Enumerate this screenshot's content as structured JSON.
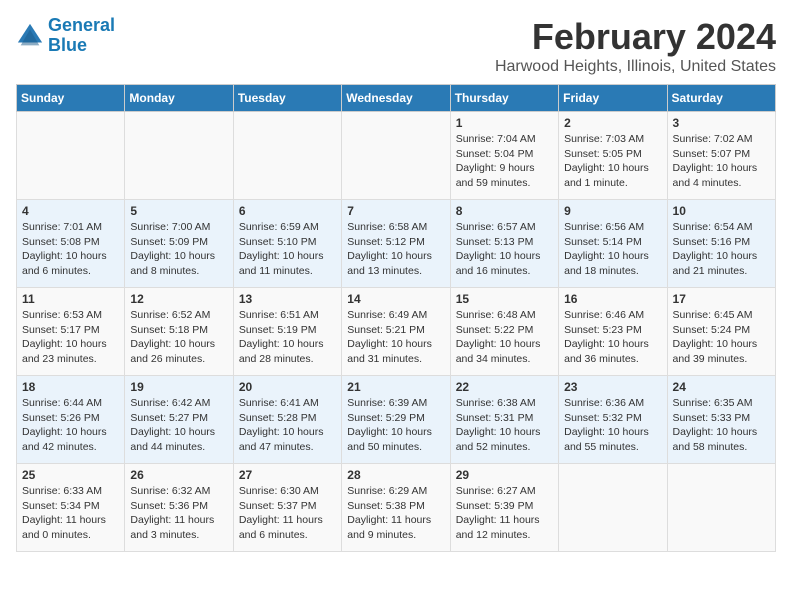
{
  "logo": {
    "line1": "General",
    "line2": "Blue"
  },
  "title": "February 2024",
  "subtitle": "Harwood Heights, Illinois, United States",
  "headers": [
    "Sunday",
    "Monday",
    "Tuesday",
    "Wednesday",
    "Thursday",
    "Friday",
    "Saturday"
  ],
  "weeks": [
    [
      {
        "day": "",
        "info": ""
      },
      {
        "day": "",
        "info": ""
      },
      {
        "day": "",
        "info": ""
      },
      {
        "day": "",
        "info": ""
      },
      {
        "day": "1",
        "info": "Sunrise: 7:04 AM\nSunset: 5:04 PM\nDaylight: 9 hours\nand 59 minutes."
      },
      {
        "day": "2",
        "info": "Sunrise: 7:03 AM\nSunset: 5:05 PM\nDaylight: 10 hours\nand 1 minute."
      },
      {
        "day": "3",
        "info": "Sunrise: 7:02 AM\nSunset: 5:07 PM\nDaylight: 10 hours\nand 4 minutes."
      }
    ],
    [
      {
        "day": "4",
        "info": "Sunrise: 7:01 AM\nSunset: 5:08 PM\nDaylight: 10 hours\nand 6 minutes."
      },
      {
        "day": "5",
        "info": "Sunrise: 7:00 AM\nSunset: 5:09 PM\nDaylight: 10 hours\nand 8 minutes."
      },
      {
        "day": "6",
        "info": "Sunrise: 6:59 AM\nSunset: 5:10 PM\nDaylight: 10 hours\nand 11 minutes."
      },
      {
        "day": "7",
        "info": "Sunrise: 6:58 AM\nSunset: 5:12 PM\nDaylight: 10 hours\nand 13 minutes."
      },
      {
        "day": "8",
        "info": "Sunrise: 6:57 AM\nSunset: 5:13 PM\nDaylight: 10 hours\nand 16 minutes."
      },
      {
        "day": "9",
        "info": "Sunrise: 6:56 AM\nSunset: 5:14 PM\nDaylight: 10 hours\nand 18 minutes."
      },
      {
        "day": "10",
        "info": "Sunrise: 6:54 AM\nSunset: 5:16 PM\nDaylight: 10 hours\nand 21 minutes."
      }
    ],
    [
      {
        "day": "11",
        "info": "Sunrise: 6:53 AM\nSunset: 5:17 PM\nDaylight: 10 hours\nand 23 minutes."
      },
      {
        "day": "12",
        "info": "Sunrise: 6:52 AM\nSunset: 5:18 PM\nDaylight: 10 hours\nand 26 minutes."
      },
      {
        "day": "13",
        "info": "Sunrise: 6:51 AM\nSunset: 5:19 PM\nDaylight: 10 hours\nand 28 minutes."
      },
      {
        "day": "14",
        "info": "Sunrise: 6:49 AM\nSunset: 5:21 PM\nDaylight: 10 hours\nand 31 minutes."
      },
      {
        "day": "15",
        "info": "Sunrise: 6:48 AM\nSunset: 5:22 PM\nDaylight: 10 hours\nand 34 minutes."
      },
      {
        "day": "16",
        "info": "Sunrise: 6:46 AM\nSunset: 5:23 PM\nDaylight: 10 hours\nand 36 minutes."
      },
      {
        "day": "17",
        "info": "Sunrise: 6:45 AM\nSunset: 5:24 PM\nDaylight: 10 hours\nand 39 minutes."
      }
    ],
    [
      {
        "day": "18",
        "info": "Sunrise: 6:44 AM\nSunset: 5:26 PM\nDaylight: 10 hours\nand 42 minutes."
      },
      {
        "day": "19",
        "info": "Sunrise: 6:42 AM\nSunset: 5:27 PM\nDaylight: 10 hours\nand 44 minutes."
      },
      {
        "day": "20",
        "info": "Sunrise: 6:41 AM\nSunset: 5:28 PM\nDaylight: 10 hours\nand 47 minutes."
      },
      {
        "day": "21",
        "info": "Sunrise: 6:39 AM\nSunset: 5:29 PM\nDaylight: 10 hours\nand 50 minutes."
      },
      {
        "day": "22",
        "info": "Sunrise: 6:38 AM\nSunset: 5:31 PM\nDaylight: 10 hours\nand 52 minutes."
      },
      {
        "day": "23",
        "info": "Sunrise: 6:36 AM\nSunset: 5:32 PM\nDaylight: 10 hours\nand 55 minutes."
      },
      {
        "day": "24",
        "info": "Sunrise: 6:35 AM\nSunset: 5:33 PM\nDaylight: 10 hours\nand 58 minutes."
      }
    ],
    [
      {
        "day": "25",
        "info": "Sunrise: 6:33 AM\nSunset: 5:34 PM\nDaylight: 11 hours\nand 0 minutes."
      },
      {
        "day": "26",
        "info": "Sunrise: 6:32 AM\nSunset: 5:36 PM\nDaylight: 11 hours\nand 3 minutes."
      },
      {
        "day": "27",
        "info": "Sunrise: 6:30 AM\nSunset: 5:37 PM\nDaylight: 11 hours\nand 6 minutes."
      },
      {
        "day": "28",
        "info": "Sunrise: 6:29 AM\nSunset: 5:38 PM\nDaylight: 11 hours\nand 9 minutes."
      },
      {
        "day": "29",
        "info": "Sunrise: 6:27 AM\nSunset: 5:39 PM\nDaylight: 11 hours\nand 12 minutes."
      },
      {
        "day": "",
        "info": ""
      },
      {
        "day": "",
        "info": ""
      }
    ]
  ]
}
